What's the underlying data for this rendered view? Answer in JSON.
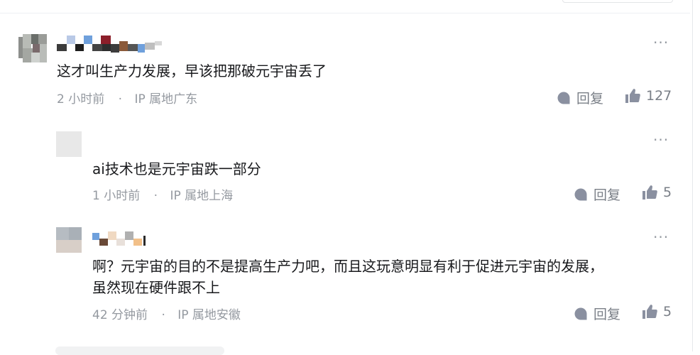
{
  "comments": [
    {
      "content": "这才叫生产力发展，早该把那破元宇宙丢了",
      "time": "2 小时前",
      "ip": "IP 属地广东",
      "reply_label": "回复",
      "likes": "127",
      "more": "···"
    },
    {
      "content": "ai技术也是元宇宙跌一部分",
      "time": "1 小时前",
      "ip": "IP 属地上海",
      "reply_label": "回复",
      "likes": "5",
      "more": "···"
    },
    {
      "content_line1": "啊？元宇宙的目的不是提高生产力吧，而且这玩意明显有利于促进元宇宙的发展，",
      "content_line2": "虽然现在硬件跟不上",
      "time": "42 分钟前",
      "ip": "IP 属地安徽",
      "reply_label": "回复",
      "likes": "5",
      "more": "···"
    }
  ],
  "meta_separator": "·",
  "icons": {
    "reply": "comment-bubble-icon",
    "like": "thumbs-up-icon",
    "more": "more-dots-icon"
  },
  "colors": {
    "text": "#18191c",
    "meta": "#9499a0",
    "icon": "#8a90a0"
  }
}
